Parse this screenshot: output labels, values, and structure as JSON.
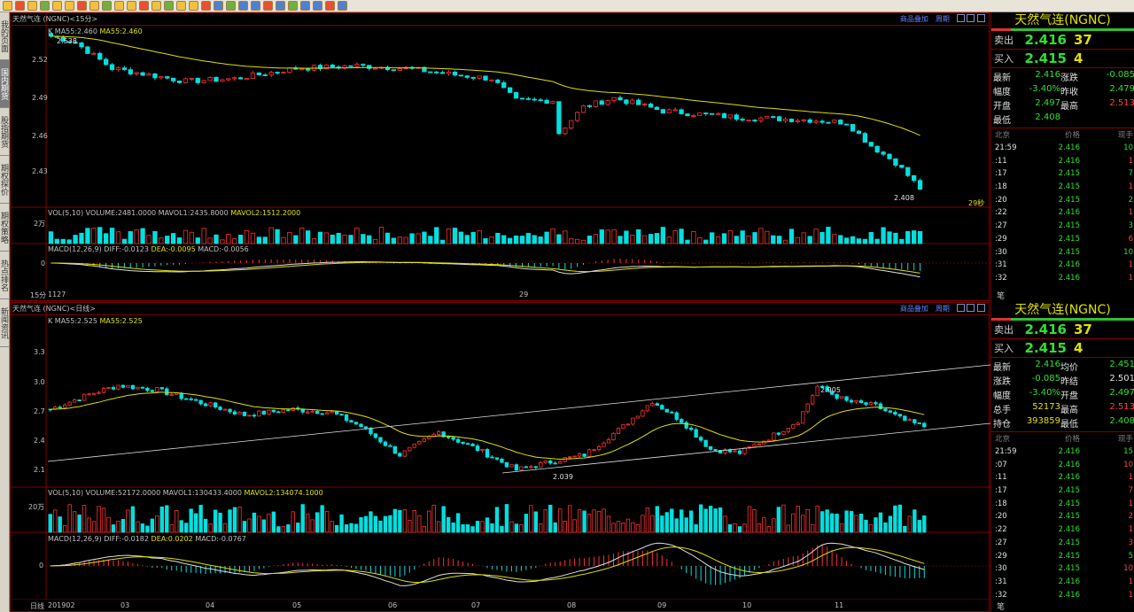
{
  "sidebar": {
    "tabs": [
      "我的页面",
      "国内期货",
      "股指期货",
      "期权探价",
      "期权策略",
      "热点排名",
      "新闻资讯"
    ]
  },
  "toolbar": {
    "icons": [
      "back",
      "home",
      "grid",
      "refresh",
      "zoom-in",
      "zoom-out",
      "pen",
      "draw",
      "filter",
      "new",
      "list",
      "chart",
      "d1",
      "d2",
      "d3",
      "d4",
      "d5",
      "d6",
      "d7",
      "d8",
      "d9",
      "d10",
      "d11",
      "d12",
      "d13",
      "d14",
      "d15",
      "d16"
    ]
  },
  "top": {
    "title": "天然气连 (NGNC)<15分>",
    "links": [
      "商品叠加",
      "周期"
    ],
    "ma_label": "K  MA55:2.460",
    "ma_label2": "MA55:2.460",
    "high_mark": "2.538",
    "low_mark": "2.408",
    "countdown": "29秒",
    "yticks": [
      "2.52",
      "2.49",
      "2.46",
      "2.43"
    ],
    "vol_label": "VOL(5,10) VOLUME:2481.0000  MAVOL1:2435.8000",
    "vol_label2": "MAVOL2:1512.2000",
    "vol_tick": "2万",
    "macd_label": "MACD(12,26,9) DIFF:-0.0123",
    "macd_label2": "DEA:-0.0095",
    "macd_label3": "MACD:-0.0056",
    "macd_tick": "0",
    "xaxis": [
      "15分",
      "1127",
      "29"
    ]
  },
  "bottom": {
    "title": "天然气连 (NGNC)<日线>",
    "links": [
      "商品叠加",
      "周期"
    ],
    "ma_label": "K  MA55:2.525",
    "ma_label2": "MA55:2.525",
    "high_mark": "2.905",
    "low_mark": "2.039",
    "yticks": [
      "3.3",
      "3.0",
      "2.7",
      "2.4",
      "2.1"
    ],
    "vol_label": "VOL(5,10) VOLUME:52172.0000  MAVOL1:130433.4000",
    "vol_label2": "MAVOL2:134074.1000",
    "vol_tick": "20万",
    "macd_label": "MACD(12,26,9) DIFF:-0.0182",
    "macd_label2": "DEA:0.0202",
    "macd_label3": "MACD:-0.0767",
    "macd_tick": "0",
    "xaxis": [
      "日线",
      "201902",
      "03",
      "04",
      "05",
      "06",
      "07",
      "08",
      "09",
      "10",
      "11"
    ]
  },
  "chart_data": [
    {
      "type": "candlestick",
      "name": "15min",
      "ylim": [
        2.4,
        2.545
      ],
      "keypoints": [
        [
          0,
          2.53
        ],
        [
          4,
          2.525
        ],
        [
          10,
          2.505
        ],
        [
          16,
          2.5
        ],
        [
          22,
          2.495
        ],
        [
          30,
          2.497
        ],
        [
          40,
          2.505
        ],
        [
          50,
          2.507
        ],
        [
          58,
          2.505
        ],
        [
          66,
          2.5
        ],
        [
          72,
          2.497
        ],
        [
          76,
          2.48
        ],
        [
          82,
          2.48
        ],
        [
          83,
          2.455
        ],
        [
          87,
          2.475
        ],
        [
          92,
          2.482
        ],
        [
          100,
          2.472
        ],
        [
          112,
          2.467
        ],
        [
          124,
          2.465
        ],
        [
          130,
          2.463
        ],
        [
          134,
          2.445
        ],
        [
          138,
          2.432
        ],
        [
          142,
          2.412
        ]
      ],
      "bars": 143
    },
    {
      "type": "candlestick",
      "name": "daily",
      "ylim": [
        2.0,
        3.55
      ],
      "keypoints": [
        [
          0,
          2.65
        ],
        [
          8,
          2.78
        ],
        [
          14,
          2.86
        ],
        [
          22,
          2.82
        ],
        [
          30,
          2.72
        ],
        [
          40,
          2.6
        ],
        [
          50,
          2.65
        ],
        [
          58,
          2.62
        ],
        [
          64,
          2.5
        ],
        [
          72,
          2.25
        ],
        [
          80,
          2.45
        ],
        [
          88,
          2.3
        ],
        [
          96,
          2.12
        ],
        [
          104,
          2.2
        ],
        [
          110,
          2.25
        ],
        [
          118,
          2.5
        ],
        [
          124,
          2.72
        ],
        [
          130,
          2.55
        ],
        [
          136,
          2.3
        ],
        [
          142,
          2.27
        ],
        [
          148,
          2.4
        ],
        [
          154,
          2.55
        ],
        [
          158,
          2.85
        ],
        [
          164,
          2.72
        ],
        [
          170,
          2.68
        ],
        [
          176,
          2.55
        ],
        [
          180,
          2.5
        ]
      ],
      "bars": 181
    }
  ],
  "quote_top": {
    "title": "天然气连(NGNC)",
    "sell_label": "卖出",
    "sell_price": "2.416",
    "sell_vol": "37",
    "buy_label": "买入",
    "buy_price": "2.415",
    "buy_vol": "4",
    "stats": [
      [
        "最新",
        "2.416",
        "涨跌",
        "-0.085"
      ],
      [
        "幅度",
        "-3.40%",
        "昨收",
        "2.479"
      ],
      [
        "开盘",
        "2.497",
        "最高",
        "2.513"
      ],
      [
        "最低",
        "2.408",
        "",
        ""
      ]
    ],
    "tick_head": [
      "北京",
      "价格",
      "现手"
    ],
    "ticks": [
      [
        "21:59",
        "2.416",
        "10"
      ],
      [
        ":11",
        "2.416",
        "1"
      ],
      [
        ":17",
        "2.415",
        "7"
      ],
      [
        ":18",
        "2.415",
        "1"
      ],
      [
        ":20",
        "2.415",
        "2"
      ],
      [
        ":22",
        "2.416",
        "1"
      ],
      [
        ":27",
        "2.415",
        "3"
      ],
      [
        ":29",
        "2.415",
        "6"
      ],
      [
        ":30",
        "2.415",
        "10"
      ],
      [
        ":31",
        "2.416",
        "1"
      ],
      [
        ":32",
        "2.416",
        "1"
      ]
    ],
    "footer": "笔"
  },
  "quote_bottom": {
    "title": "天然气连(NGNC)",
    "sell_label": "卖出",
    "sell_price": "2.416",
    "sell_vol": "37",
    "buy_label": "买入",
    "buy_price": "2.415",
    "buy_vol": "4",
    "stats": [
      [
        "最新",
        "2.416",
        "均价",
        "2.451"
      ],
      [
        "涨跌",
        "-0.085",
        "昨结",
        "2.501"
      ],
      [
        "幅度",
        "-3.40%",
        "开盘",
        "2.497"
      ],
      [
        "总手",
        "52173",
        "最高",
        "2.513"
      ],
      [
        "持仓",
        "393859",
        "最低",
        "2.408"
      ]
    ],
    "tick_head": [
      "北京",
      "价格",
      "现手"
    ],
    "ticks": [
      [
        "21:59",
        "2.416",
        "15"
      ],
      [
        ":07",
        "2.416",
        "10"
      ],
      [
        ":11",
        "2.416",
        "1"
      ],
      [
        ":17",
        "2.415",
        "7"
      ],
      [
        ":18",
        "2.415",
        "1"
      ],
      [
        ":20",
        "2.415",
        "2"
      ],
      [
        ":22",
        "2.416",
        "1"
      ],
      [
        ":27",
        "2.415",
        "3"
      ],
      [
        ":29",
        "2.415",
        "5"
      ],
      [
        ":30",
        "2.415",
        "10"
      ],
      [
        ":31",
        "2.416",
        "1"
      ],
      [
        ":32",
        "2.416",
        "1"
      ]
    ],
    "footer": "笔"
  },
  "colors": {
    "up": "#ff3030",
    "down": "#00e0e0",
    "ma": "#e0e000",
    "border": "#800000"
  }
}
